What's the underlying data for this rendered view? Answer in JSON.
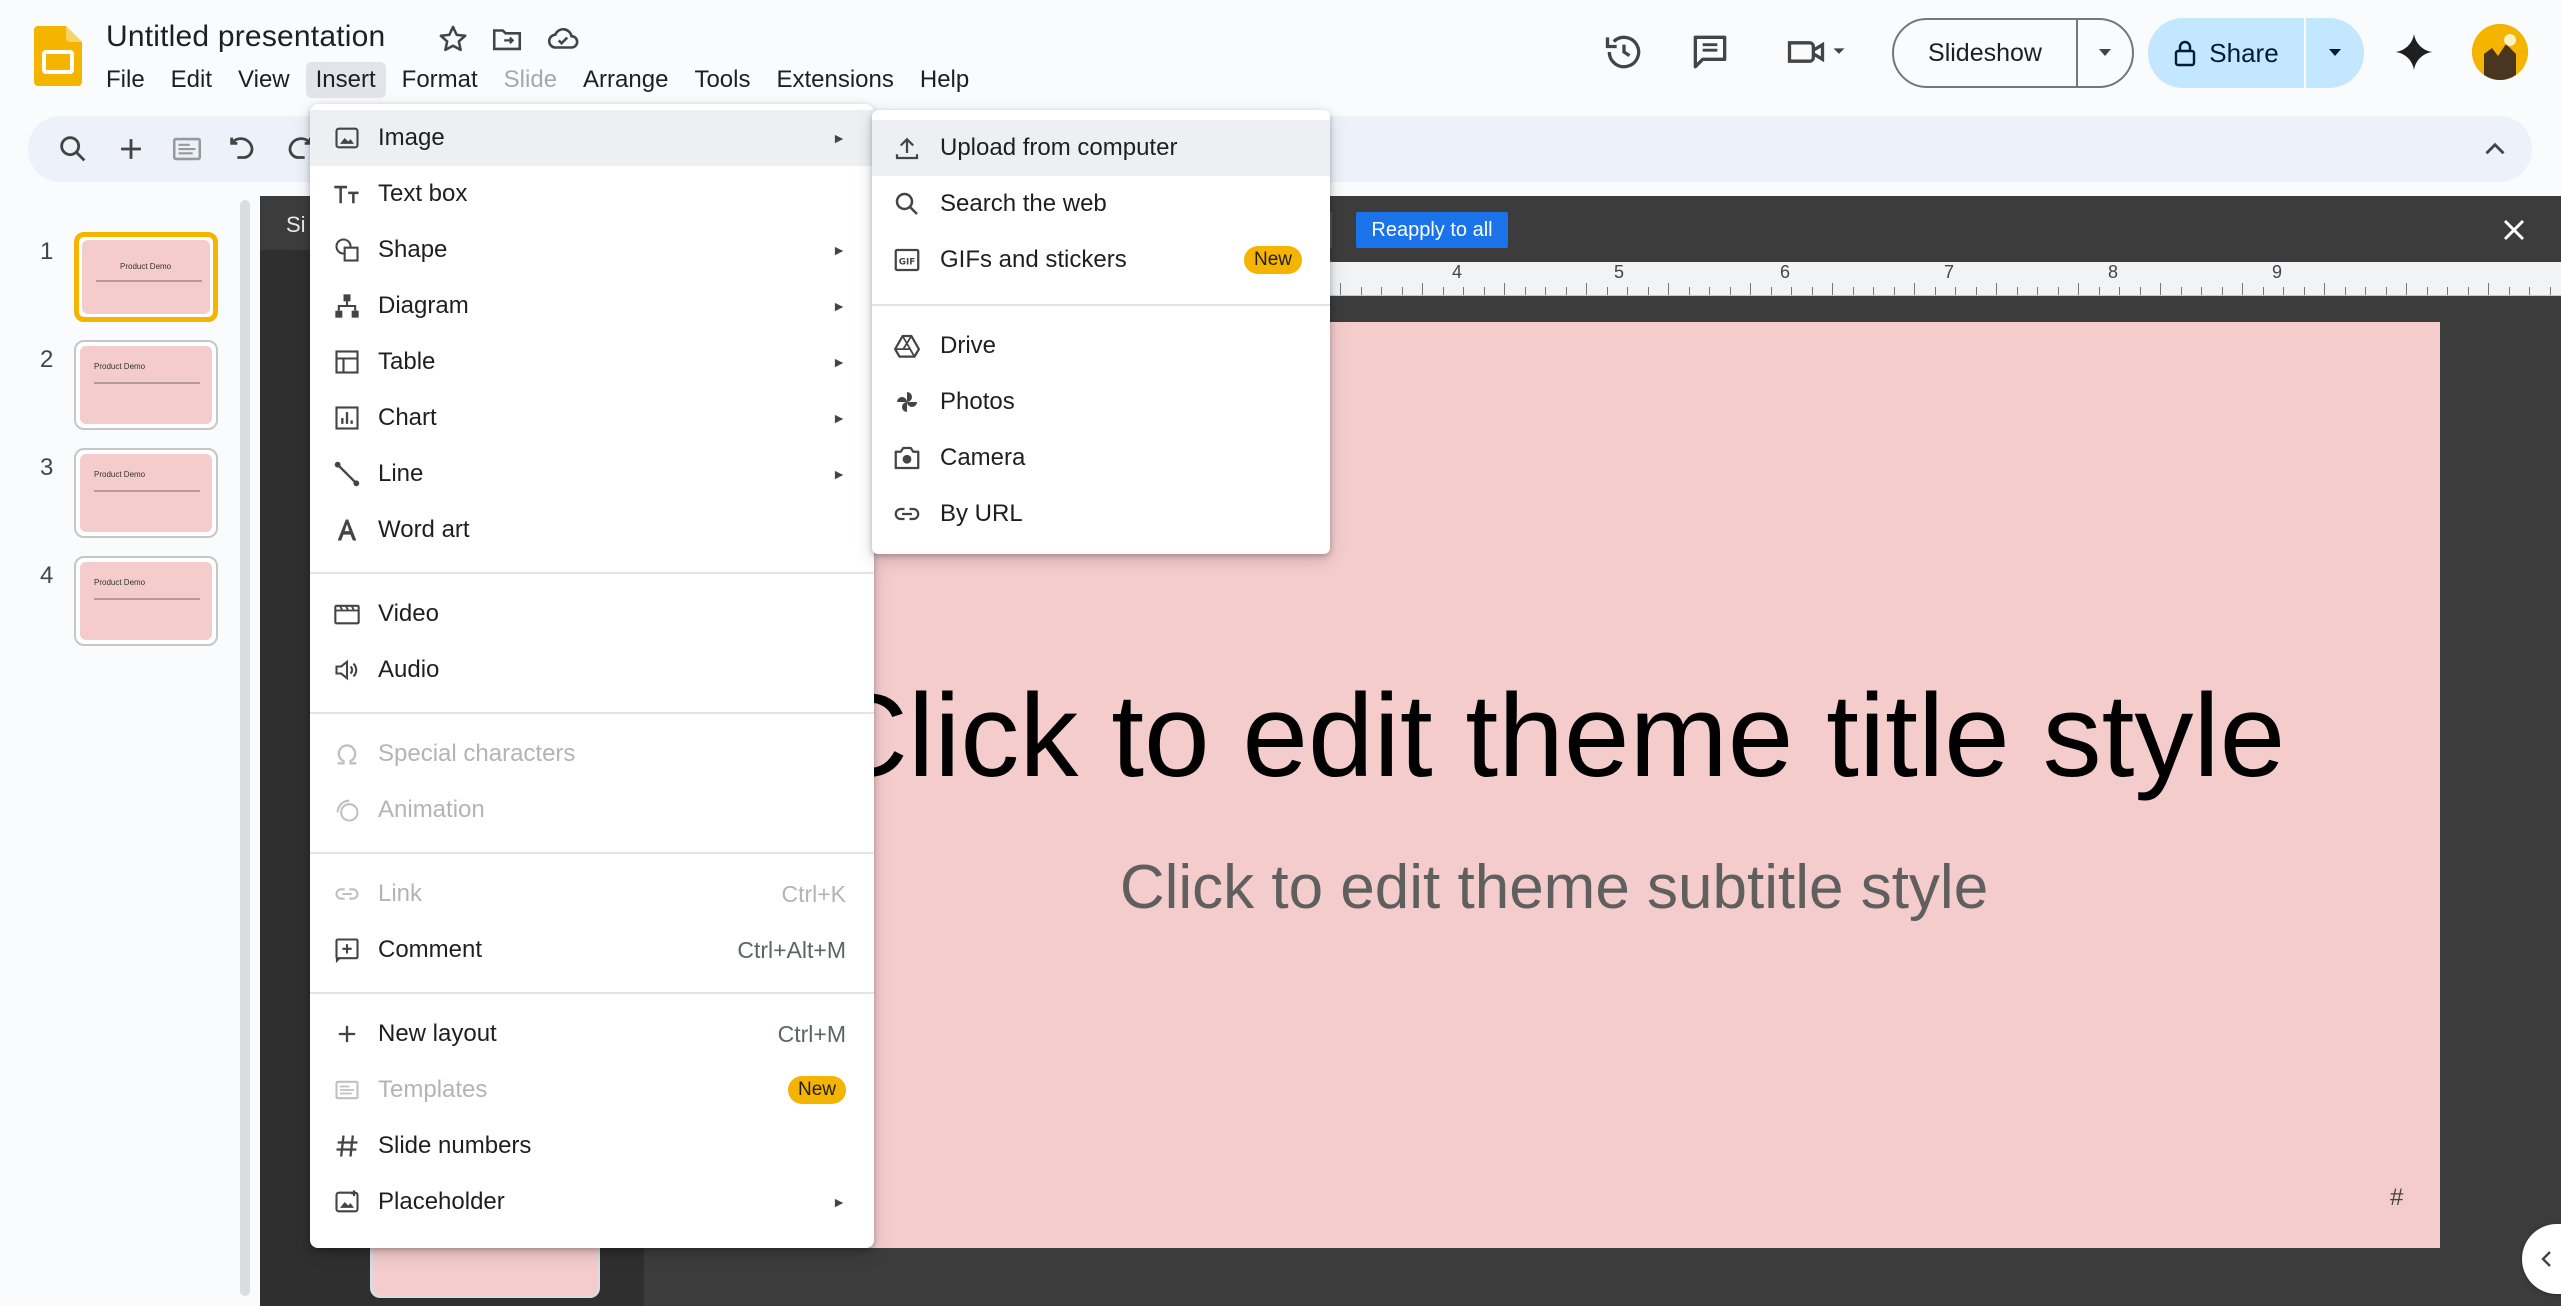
{
  "header": {
    "doc_title": "Untitled presentation",
    "menus": [
      "File",
      "Edit",
      "View",
      "Insert",
      "Format",
      "Slide",
      "Arrange",
      "Tools",
      "Extensions",
      "Help"
    ],
    "active_menu": "Insert",
    "slideshow_label": "Slideshow",
    "share_label": "Share"
  },
  "filmstrip": {
    "slides": [
      {
        "num": "1",
        "title": "Product Demo"
      },
      {
        "num": "2",
        "title": "Product Demo"
      },
      {
        "num": "3",
        "title": "Product Demo"
      },
      {
        "num": "4",
        "title": "Product Demo"
      }
    ]
  },
  "editor": {
    "theme_label": "Si",
    "reapply_label": "Reapply to all",
    "ruler_numbers": [
      "4",
      "5",
      "6",
      "7",
      "8",
      "9"
    ],
    "slide_title": "Click to edit theme title style",
    "slide_subtitle": "Click to edit theme subtitle style",
    "slide_number_placeholder": "#"
  },
  "insert_menu": {
    "items": [
      {
        "label": "Image",
        "icon": "image-icon",
        "submenu": true
      },
      {
        "label": "Text box",
        "icon": "text-box-icon"
      },
      {
        "label": "Shape",
        "icon": "shape-icon",
        "submenu": true
      },
      {
        "label": "Diagram",
        "icon": "diagram-icon",
        "submenu": true
      },
      {
        "label": "Table",
        "icon": "table-icon",
        "submenu": true
      },
      {
        "label": "Chart",
        "icon": "chart-icon",
        "submenu": true
      },
      {
        "label": "Line",
        "icon": "line-icon",
        "submenu": true
      },
      {
        "label": "Word art",
        "icon": "word-art-icon"
      },
      {
        "label": "Video",
        "icon": "video-icon"
      },
      {
        "label": "Audio",
        "icon": "audio-icon"
      },
      {
        "label": "Special characters",
        "icon": "omega-icon",
        "disabled": true
      },
      {
        "label": "Animation",
        "icon": "animation-icon",
        "disabled": true
      },
      {
        "label": "Link",
        "icon": "link-icon",
        "shortcut": "Ctrl+K",
        "disabled": true
      },
      {
        "label": "Comment",
        "icon": "comment-add-icon",
        "shortcut": "Ctrl+Alt+M"
      },
      {
        "label": "New layout",
        "icon": "plus-icon",
        "shortcut": "Ctrl+M"
      },
      {
        "label": "Templates",
        "icon": "templates-icon",
        "badge": "New",
        "disabled": true
      },
      {
        "label": "Slide numbers",
        "icon": "hash-icon"
      },
      {
        "label": "Placeholder",
        "icon": "placeholder-icon",
        "submenu": true
      }
    ]
  },
  "image_submenu": {
    "items": [
      {
        "label": "Upload from computer",
        "icon": "upload-icon"
      },
      {
        "label": "Search the web",
        "icon": "search-icon"
      },
      {
        "label": "GIFs and stickers",
        "icon": "gif-icon",
        "badge": "New"
      },
      {
        "label": "Drive",
        "icon": "drive-icon"
      },
      {
        "label": "Photos",
        "icon": "photos-icon"
      },
      {
        "label": "Camera",
        "icon": "camera-icon"
      },
      {
        "label": "By URL",
        "icon": "link-icon"
      }
    ]
  },
  "colors": {
    "accent_blue": "#1a73e8",
    "share_bg": "#c2e7ff",
    "badge_yellow": "#f4b400",
    "slide_bg": "#f4cccc",
    "editor_bg": "#3c3c3c"
  }
}
